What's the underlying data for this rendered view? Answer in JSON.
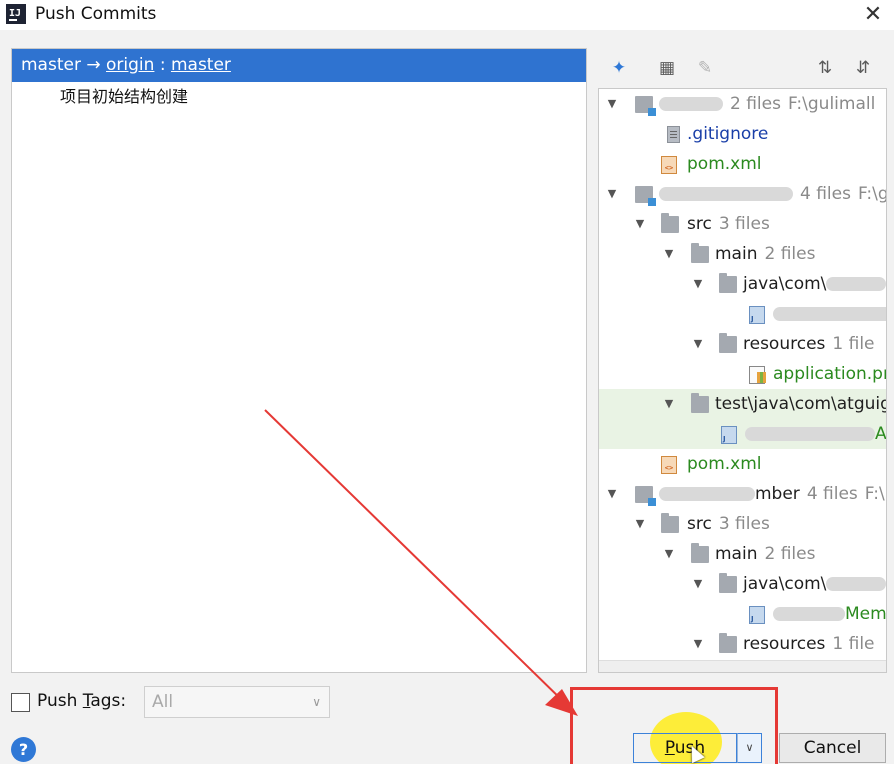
{
  "window": {
    "title": "Push Commits",
    "app_icon": "IJ"
  },
  "branch": {
    "local": "master",
    "arrow": "→",
    "remote": "origin",
    "separator": ":",
    "remote_branch": "master"
  },
  "commits": [
    {
      "message": "项目初始结构创建"
    }
  ],
  "tree": [
    {
      "id": "m1",
      "kind": "module",
      "label": "",
      "count": "2 files",
      "path": "F:\\gulimall"
    },
    {
      "id": "gitignore",
      "kind": "gitfile",
      "label": ".gitignore"
    },
    {
      "id": "pom1",
      "kind": "xml",
      "label": "pom.xml"
    },
    {
      "id": "m2",
      "kind": "module",
      "label": "",
      "count": "4 files",
      "path": "F:\\g"
    },
    {
      "id": "src1",
      "kind": "folder",
      "label": "src",
      "count": "3 files"
    },
    {
      "id": "main1",
      "kind": "folder",
      "label": "main",
      "count": "2 files"
    },
    {
      "id": "java1",
      "kind": "folder",
      "label": "java\\com\\"
    },
    {
      "id": "jf1",
      "kind": "java",
      "label": ""
    },
    {
      "id": "res1",
      "kind": "folder",
      "label": "resources",
      "count": "1 file"
    },
    {
      "id": "app1",
      "kind": "properties",
      "label": "application.pr"
    },
    {
      "id": "test1",
      "kind": "folder",
      "label": "test\\java\\com\\atguig"
    },
    {
      "id": "jf2",
      "kind": "java",
      "label": "A"
    },
    {
      "id": "pom2",
      "kind": "xml",
      "label": "pom.xml"
    },
    {
      "id": "m3",
      "kind": "module",
      "label": "mber",
      "count": "4 files",
      "path": "F:\\"
    },
    {
      "id": "src2",
      "kind": "folder",
      "label": "src",
      "count": "3 files"
    },
    {
      "id": "main2",
      "kind": "folder",
      "label": "main",
      "count": "2 files"
    },
    {
      "id": "java2",
      "kind": "folder",
      "label": "java\\com\\"
    },
    {
      "id": "jf3",
      "kind": "java",
      "label": "Meml"
    },
    {
      "id": "res2",
      "kind": "folder",
      "label": "resources",
      "count": "1 file"
    }
  ],
  "push_tags": {
    "label_prefix": "Push ",
    "label_mnemonic": "T",
    "label_suffix": "ags:",
    "checked": false,
    "selected": "All"
  },
  "buttons": {
    "push_mnemonic": "P",
    "push_rest": "ush",
    "cancel": "Cancel"
  },
  "colors": {
    "selection": "#2f73d0",
    "accent_red": "#e53935",
    "cursor_highlight": "#ffec19"
  }
}
